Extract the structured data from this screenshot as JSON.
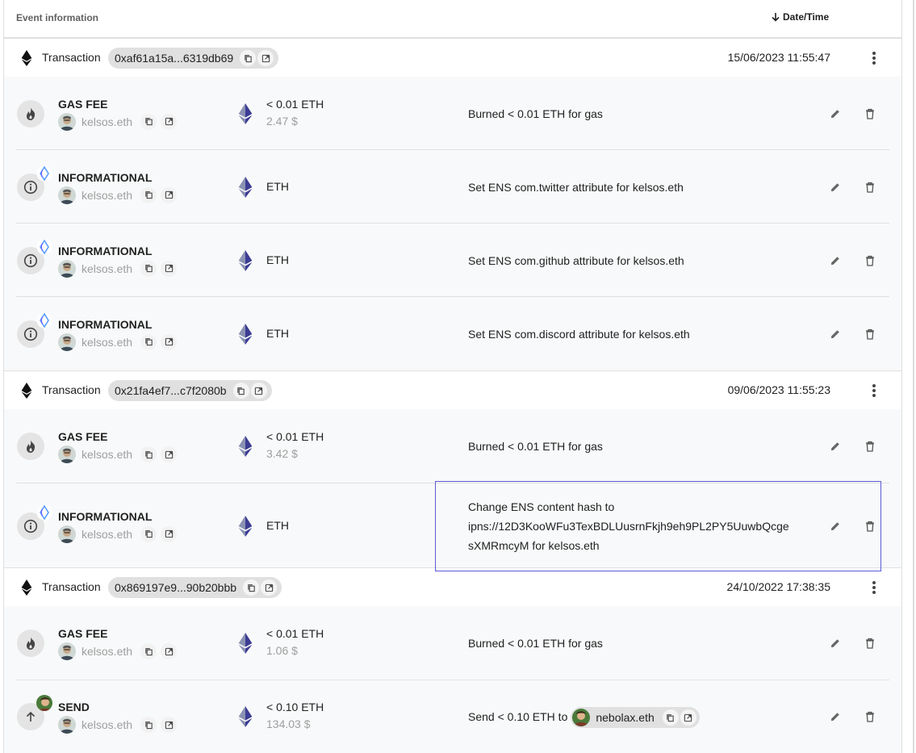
{
  "header": {
    "event_information": "Event information",
    "date_time": "Date/Time",
    "sort_icon": "arrow-down-icon"
  },
  "transactions": [
    {
      "label": "Transaction",
      "hash": "0xaf61a15a...6319db69",
      "date": "15/06/2023 11:55:47",
      "events": [
        {
          "type": "GAS FEE",
          "icon": "fire-icon",
          "address": "kelsos.eth",
          "asset": "ETH",
          "amount": "< 0.01 ETH",
          "fiat": "2.47 $",
          "description": "Burned < 0.01 ETH for gas"
        },
        {
          "type": "INFORMATIONAL",
          "icon": "info-icon",
          "badge": "ens-icon",
          "address": "kelsos.eth",
          "asset": "ETH",
          "amount": "ETH",
          "description": "Set ENS com.twitter attribute for kelsos.eth"
        },
        {
          "type": "INFORMATIONAL",
          "icon": "info-icon",
          "badge": "ens-icon",
          "address": "kelsos.eth",
          "asset": "ETH",
          "amount": "ETH",
          "description": "Set ENS com.github attribute for kelsos.eth"
        },
        {
          "type": "INFORMATIONAL",
          "icon": "info-icon",
          "badge": "ens-icon",
          "address": "kelsos.eth",
          "asset": "ETH",
          "amount": "ETH",
          "description": "Set ENS com.discord attribute for kelsos.eth"
        }
      ]
    },
    {
      "label": "Transaction",
      "hash": "0x21fa4ef7...c7f2080b",
      "date": "09/06/2023 11:55:23",
      "events": [
        {
          "type": "GAS FEE",
          "icon": "fire-icon",
          "address": "kelsos.eth",
          "asset": "ETH",
          "amount": "< 0.01 ETH",
          "fiat": "3.42 $",
          "description": "Burned < 0.01 ETH for gas"
        },
        {
          "type": "INFORMATIONAL",
          "icon": "info-icon",
          "badge": "ens-icon",
          "address": "kelsos.eth",
          "asset": "ETH",
          "amount": "ETH",
          "description_lines": [
            "Change ENS content hash to",
            "ipns://12D3KooWFu3TexBDLUusrnFkjh9eh9PL2PY5UuwbQcge",
            "sXMRmcyM for kelsos.eth"
          ]
        }
      ]
    },
    {
      "label": "Transaction",
      "hash": "0x869197e9...90b20bbb",
      "date": "24/10/2022 17:38:35",
      "events": [
        {
          "type": "GAS FEE",
          "icon": "fire-icon",
          "address": "kelsos.eth",
          "asset": "ETH",
          "amount": "< 0.01 ETH",
          "fiat": "1.06 $",
          "description": "Burned < 0.01 ETH for gas"
        },
        {
          "type": "SEND",
          "icon": "arrow-up-icon",
          "address": "kelsos.eth",
          "asset": "ETH",
          "amount": "< 0.10 ETH",
          "fiat": "134.03 $",
          "description": "Send < 0.10 ETH to",
          "peer": "nebolax.eth"
        }
      ]
    }
  ],
  "colors": {
    "divider": "#e0e0e0",
    "group_bg": "#f8f9fa",
    "pill_bg": "#e0e0e0",
    "eth": "#627eea",
    "highlight": "#5b5bd6"
  }
}
